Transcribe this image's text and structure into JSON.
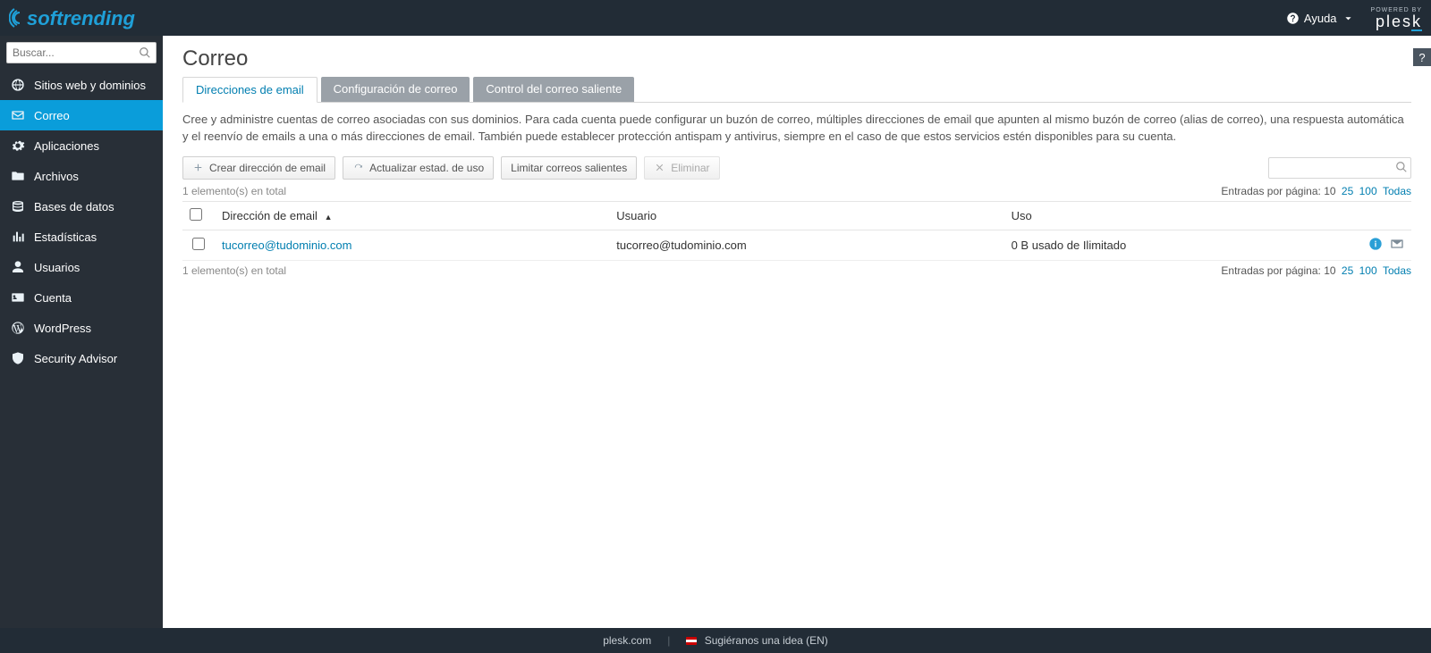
{
  "brand": {
    "logo_text": "softrending",
    "powered_small": "POWERED BY",
    "powered_main": "plesk"
  },
  "topbar": {
    "help_label": "Ayuda"
  },
  "search": {
    "placeholder": "Buscar..."
  },
  "sidebar": {
    "items": [
      {
        "label": "Sitios web y dominios",
        "icon": "globe-icon"
      },
      {
        "label": "Correo",
        "icon": "mail-icon",
        "active": true
      },
      {
        "label": "Aplicaciones",
        "icon": "gear-icon"
      },
      {
        "label": "Archivos",
        "icon": "folder-icon"
      },
      {
        "label": "Bases de datos",
        "icon": "database-icon"
      },
      {
        "label": "Estadísticas",
        "icon": "stats-icon"
      },
      {
        "label": "Usuarios",
        "icon": "user-icon"
      },
      {
        "label": "Cuenta",
        "icon": "card-icon"
      },
      {
        "label": "WordPress",
        "icon": "wordpress-icon"
      },
      {
        "label": "Security Advisor",
        "icon": "shield-icon"
      }
    ]
  },
  "page": {
    "title": "Correo",
    "help_q": "?",
    "tabs": [
      {
        "label": "Direcciones de email",
        "active": true
      },
      {
        "label": "Configuración de correo"
      },
      {
        "label": "Control del correo saliente"
      }
    ],
    "description": "Cree y administre cuentas de correo asociadas con sus dominios. Para cada cuenta puede configurar un buzón de correo, múltiples direcciones de email que apunten al mismo buzón de correo (alias de correo), una respuesta automática y el reenvío de emails a una o más direcciones de email. También puede establecer protección antispam y antivirus, siempre en el caso de que estos servicios estén disponibles para su cuenta."
  },
  "toolbar": {
    "create_label": "Crear dirección de email",
    "refresh_label": "Actualizar estad. de uso",
    "limit_label": "Limitar correos salientes",
    "delete_label": "Eliminar"
  },
  "list": {
    "total_text": "1 elemento(s) en total",
    "paging_label": "Entradas por página:",
    "paging_options": [
      "10",
      "25",
      "100",
      "Todas"
    ],
    "paging_current": "10",
    "columns": {
      "email": "Dirección de email",
      "user": "Usuario",
      "usage": "Uso"
    },
    "rows": [
      {
        "email": "tucorreo@tudominio.com",
        "user": "tucorreo@tudominio.com",
        "usage": "0 B usado de Ilimitado"
      }
    ]
  },
  "footer": {
    "plesk_link": "plesk.com",
    "suggest_label": "Sugiéranos una idea (EN)"
  }
}
